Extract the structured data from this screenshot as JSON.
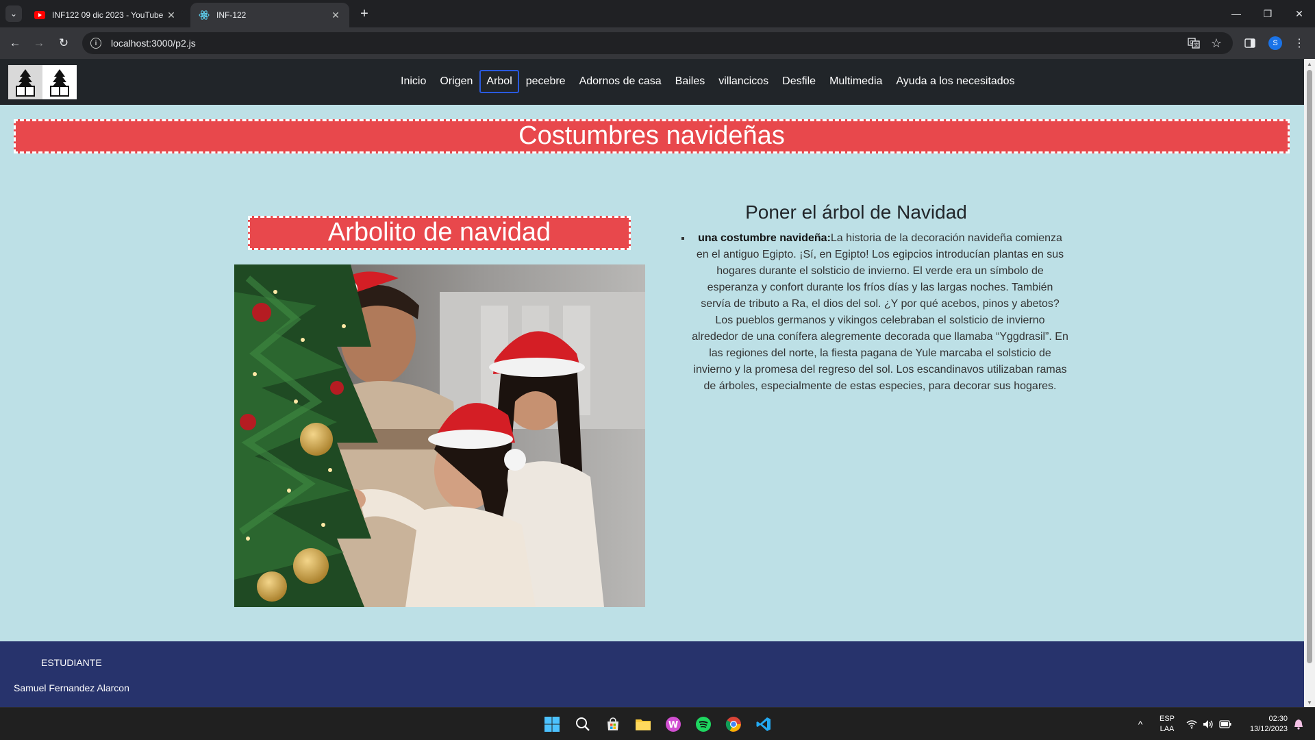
{
  "browser": {
    "tabs": [
      {
        "title": "INF122 09 dic 2023 - YouTube",
        "icon": "youtube-icon",
        "active": false
      },
      {
        "title": "INF-122",
        "icon": "react-icon",
        "active": true
      }
    ],
    "url": "localhost:3000/p2.js",
    "profile_initial": "S"
  },
  "site": {
    "nav": [
      "Inicio",
      "Origen",
      "Arbol",
      "pecebre",
      "Adornos de casa",
      "Bailes",
      "villancicos",
      "Desfile",
      "Multimedia",
      "Ayuda a los necesitados"
    ],
    "active_nav": "Arbol",
    "banner": "Costumbres navideñas",
    "section_banner": "Arbolito de navidad",
    "article": {
      "title": "Poner el árbol de Navidad",
      "item_bold": "una costumbre navideña:",
      "item_text": "La historia de la decoración navideña comienza en el antiguo Egipto. ¡Sí, en Egipto! Los egipcios introducían plantas en sus hogares durante el solsticio de invierno. El verde era un símbolo de esperanza y confort durante los fríos días y las largas noches. También servía de tributo a Ra, el dios del sol. ¿Y por qué acebos, pinos y abetos? Los pueblos germanos y vikingos celebraban el solsticio de invierno alrededor de una conífera alegremente decorada que llamaba “Yggdrasil”. En las regiones del norte, la fiesta pagana de Yule marcaba el solsticio de invierno y la promesa del regreso del sol. Los escandinavos utilizaban ramas de árboles, especialmente de estas especies, para decorar sus hogares."
    },
    "footer": {
      "label": "ESTUDIANTE",
      "name": "Samuel Fernandez Alarcon"
    }
  },
  "taskbar": {
    "language": "ESP",
    "layout": "LAA",
    "time": "02:30",
    "date": "13/12/2023"
  },
  "colors": {
    "page_bg": "#bde0e6",
    "banner_bg": "#e8484c",
    "navbar_bg": "#212529",
    "footer_bg": "#27336c"
  }
}
